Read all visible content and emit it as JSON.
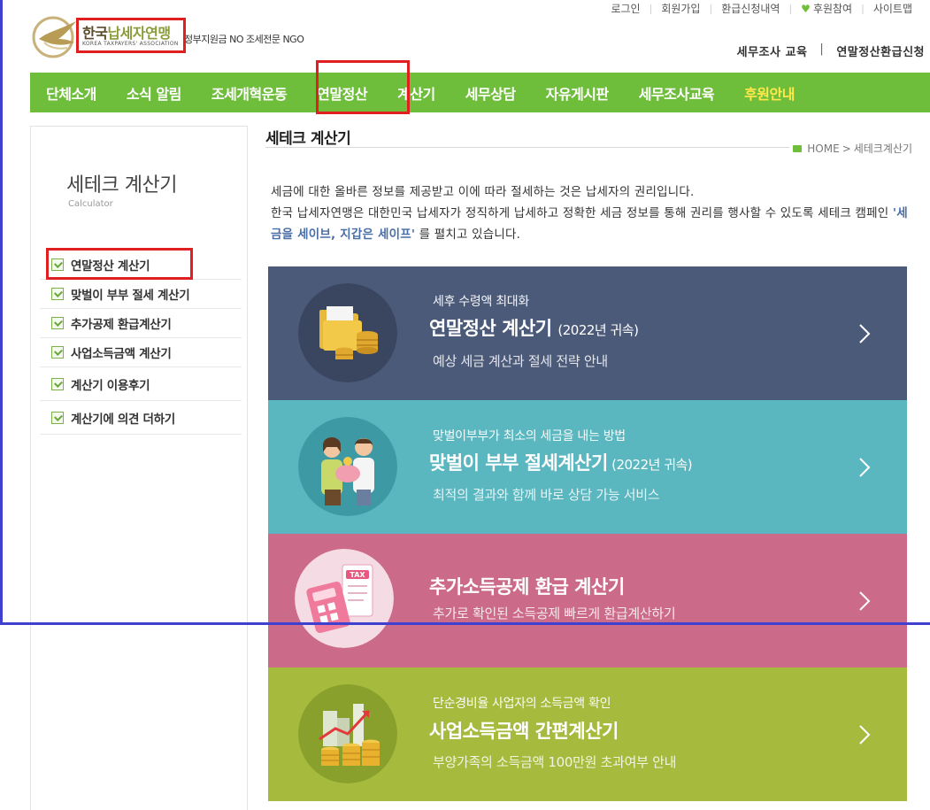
{
  "utility": {
    "login": "로그인",
    "join": "회원가입",
    "refund_history": "환급신청내역",
    "sponsor": "후원참여",
    "sitemap": "사이트맵"
  },
  "logo": {
    "main_a": "한국",
    "main_b": "납세자연맹",
    "sub": "KOREA TAXPAYERS' ASSOCIATION",
    "tagline": "정부지원금 NO 조세전문 NGO"
  },
  "quick_links": {
    "audit_edu": "세무조사 교육",
    "separator": "|",
    "year_end_refund": "연말정산환급신청"
  },
  "gnb": {
    "items": [
      "단체소개",
      "소식 알림",
      "조세개혁운동",
      "연말정산",
      "계산기",
      "세무상담",
      "자유게시판",
      "세무조사교육"
    ],
    "donate": "후원안내"
  },
  "lnb": {
    "title": "세테크 계산기",
    "subtitle": "Calculator",
    "items": [
      "연말정산 계산기",
      "맞벌이 부부 절세 계산기",
      "추가공제 환급계산기",
      "사업소득금액 계산기",
      "계산기 이용후기",
      "계산기에 의견 더하기"
    ]
  },
  "content": {
    "title": "세테크 계산기",
    "breadcrumb_home": "HOME",
    "breadcrumb_sep": ">",
    "breadcrumb_current": "세테크계산기",
    "intro_line1": "세금에 대한 올바른 정보를 제공받고 이에 따라 절세하는 것은 납세자의 권리입니다.",
    "intro_line2a": "한국 납세자연맹은 대한민국 납세자가 정직하게 납세하고 정확한 세금 정보를 통해 권리를 행사할 수 있도록 세테크 캠페인 ",
    "intro_highlight": "'세금을 세이브, 지갑은 세이프'",
    "intro_line2b": " 를 펼치고 있습니다."
  },
  "banners": [
    {
      "kicker": "세후 수령액 최대화",
      "head": "연말정산 계산기",
      "note": "(2022년 귀속)",
      "desc": "예상 세금 계산과 절세 전략 안내"
    },
    {
      "kicker": "맞벌이부부가 최소의 세금을 내는 방법",
      "head": "맞벌이 부부 절세계산기",
      "note": " (2022년 귀속)",
      "desc": "최적의 결과와 함께 바로 상담 가능 서비스"
    },
    {
      "kicker": "",
      "head": "추가소득공제 환급 계산기",
      "note": "",
      "desc": "추가로 확인된 소득공제 빠르게 환급계산하기"
    },
    {
      "kicker": "단순경비율 사업자의 소득금액 확인",
      "head": "사업소득금액 간편계산기",
      "note": "",
      "desc": "부양가족의 소득금액 100만원 초과여부 안내"
    }
  ],
  "illustration_labels": {
    "tax_tag": "TAX"
  },
  "colors": {
    "gnb_green": "#6fbe3b",
    "donate_yellow": "#ffe84a",
    "banner1": "#4c5a7a",
    "banner2": "#5ab6bf",
    "banner3": "#cc6a8a",
    "banner4": "#a6bb3d",
    "annotation_red": "#e02020",
    "annotation_blue": "#4040d0"
  }
}
